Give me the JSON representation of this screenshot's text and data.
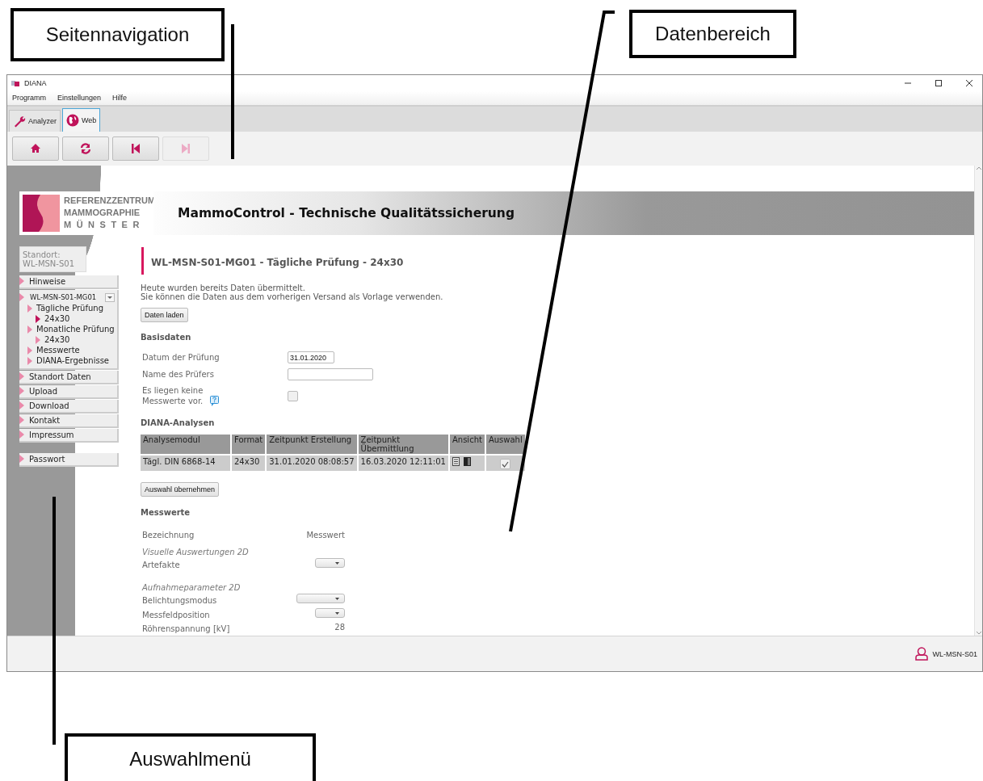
{
  "annotations": [
    {
      "label": "Seitennavigation"
    },
    {
      "label": "Datenbereich"
    },
    {
      "label": "Auswahlmenü"
    }
  ],
  "window": {
    "title": "DIANA"
  },
  "menu_bar": [
    "Programm",
    "Einstellungen",
    "Hilfe"
  ],
  "tabs": [
    {
      "label": "Analyzer",
      "kind": "wrench",
      "selected": false
    },
    {
      "label": "Web",
      "kind": "globe",
      "selected": true
    }
  ],
  "toolbar": [
    {
      "kind": "home",
      "disabled": false
    },
    {
      "kind": "refresh",
      "disabled": false
    },
    {
      "kind": "back",
      "disabled": false
    },
    {
      "kind": "forward",
      "disabled": true
    }
  ],
  "logo": {
    "lines": [
      "REFERENZZENTRUM",
      "MAMMOGRAPHIE",
      "MÜNSTER"
    ]
  },
  "header_title": "MammoControl - Technische Qualitätssicherung",
  "sidebar": {
    "location_label": "Standort:",
    "location": "WL-MSN-S01",
    "items": [
      {
        "kind": "link",
        "label": "Hinweise",
        "selected": false
      },
      {
        "kind": "device",
        "label": "WL-MSN-S01-MG01",
        "selected": false,
        "children": [
          {
            "label": "Tägliche Prüfung",
            "selected": false,
            "children": [
              {
                "label": "24x30",
                "selected": true
              }
            ]
          },
          {
            "label": "Monatliche Prüfung",
            "selected": false,
            "children": [
              {
                "label": "24x30",
                "selected": false
              }
            ]
          },
          {
            "label": "Messwerte",
            "selected": false
          },
          {
            "label": "DIANA-Ergebnisse",
            "selected": false
          }
        ]
      },
      {
        "kind": "link",
        "label": "Standort Daten",
        "selected": false
      },
      {
        "kind": "link",
        "label": "Upload",
        "selected": false
      },
      {
        "kind": "link",
        "label": "Download",
        "selected": false
      },
      {
        "kind": "link",
        "label": "Kontakt",
        "selected": false
      },
      {
        "kind": "link",
        "label": "Impressum",
        "selected": false
      },
      {
        "kind": "separate",
        "label": "Passwort",
        "selected": false
      }
    ]
  },
  "page_title": "WL-MSN-S01-MG01 - Tägliche Prüfung - 24x30",
  "notice": [
    "Heute wurden bereits Daten übermittelt.",
    "Sie können die Daten aus dem vorherigen Versand als Vorlage verwenden."
  ],
  "load_button": "Daten laden",
  "basisdaten": {
    "heading": "Basisdaten",
    "fields": [
      {
        "kind": "date",
        "label": "Datum der Prüfung",
        "value": "31.01.2020"
      },
      {
        "kind": "text",
        "label": "Name des Prüfers"
      },
      {
        "kind": "checkbox",
        "label": "Es liegen keine Messwerte vor.",
        "checked": false
      }
    ]
  },
  "analyses": {
    "heading": "DIANA-Analysen",
    "columns": [
      "Analysemodul",
      "Format",
      "Zeitpunkt Erstellung",
      "Zeitpunkt Übermittlung",
      "Ansicht",
      "Auswahl"
    ],
    "rows": [
      {
        "cells": [
          "Tägl. DIN 6868-14",
          "24x30",
          "31.01.2020 08:08:57",
          "16.03.2020 12:11:01"
        ],
        "checked": true
      }
    ]
  },
  "apply_button": "Auswahl übernehmen",
  "measurements": {
    "heading": "Messwerte",
    "columns": [
      "Bezeichnung",
      "Messwert"
    ],
    "rows": [
      {
        "kind": "group",
        "label": "Visuelle Auswertungen 2D"
      },
      {
        "kind": "select",
        "label": "Artefakte"
      },
      {
        "kind": "group",
        "label": "Aufnahmeparameter 2D"
      },
      {
        "kind": "wideselect",
        "label": "Belichtungsmodus"
      },
      {
        "kind": "select",
        "label": "Messfeldposition"
      },
      {
        "kind": "value",
        "label": "Röhrenspannung [kV]",
        "value": "28"
      }
    ]
  },
  "status_bar": {
    "user": "WL-MSN-S01"
  }
}
